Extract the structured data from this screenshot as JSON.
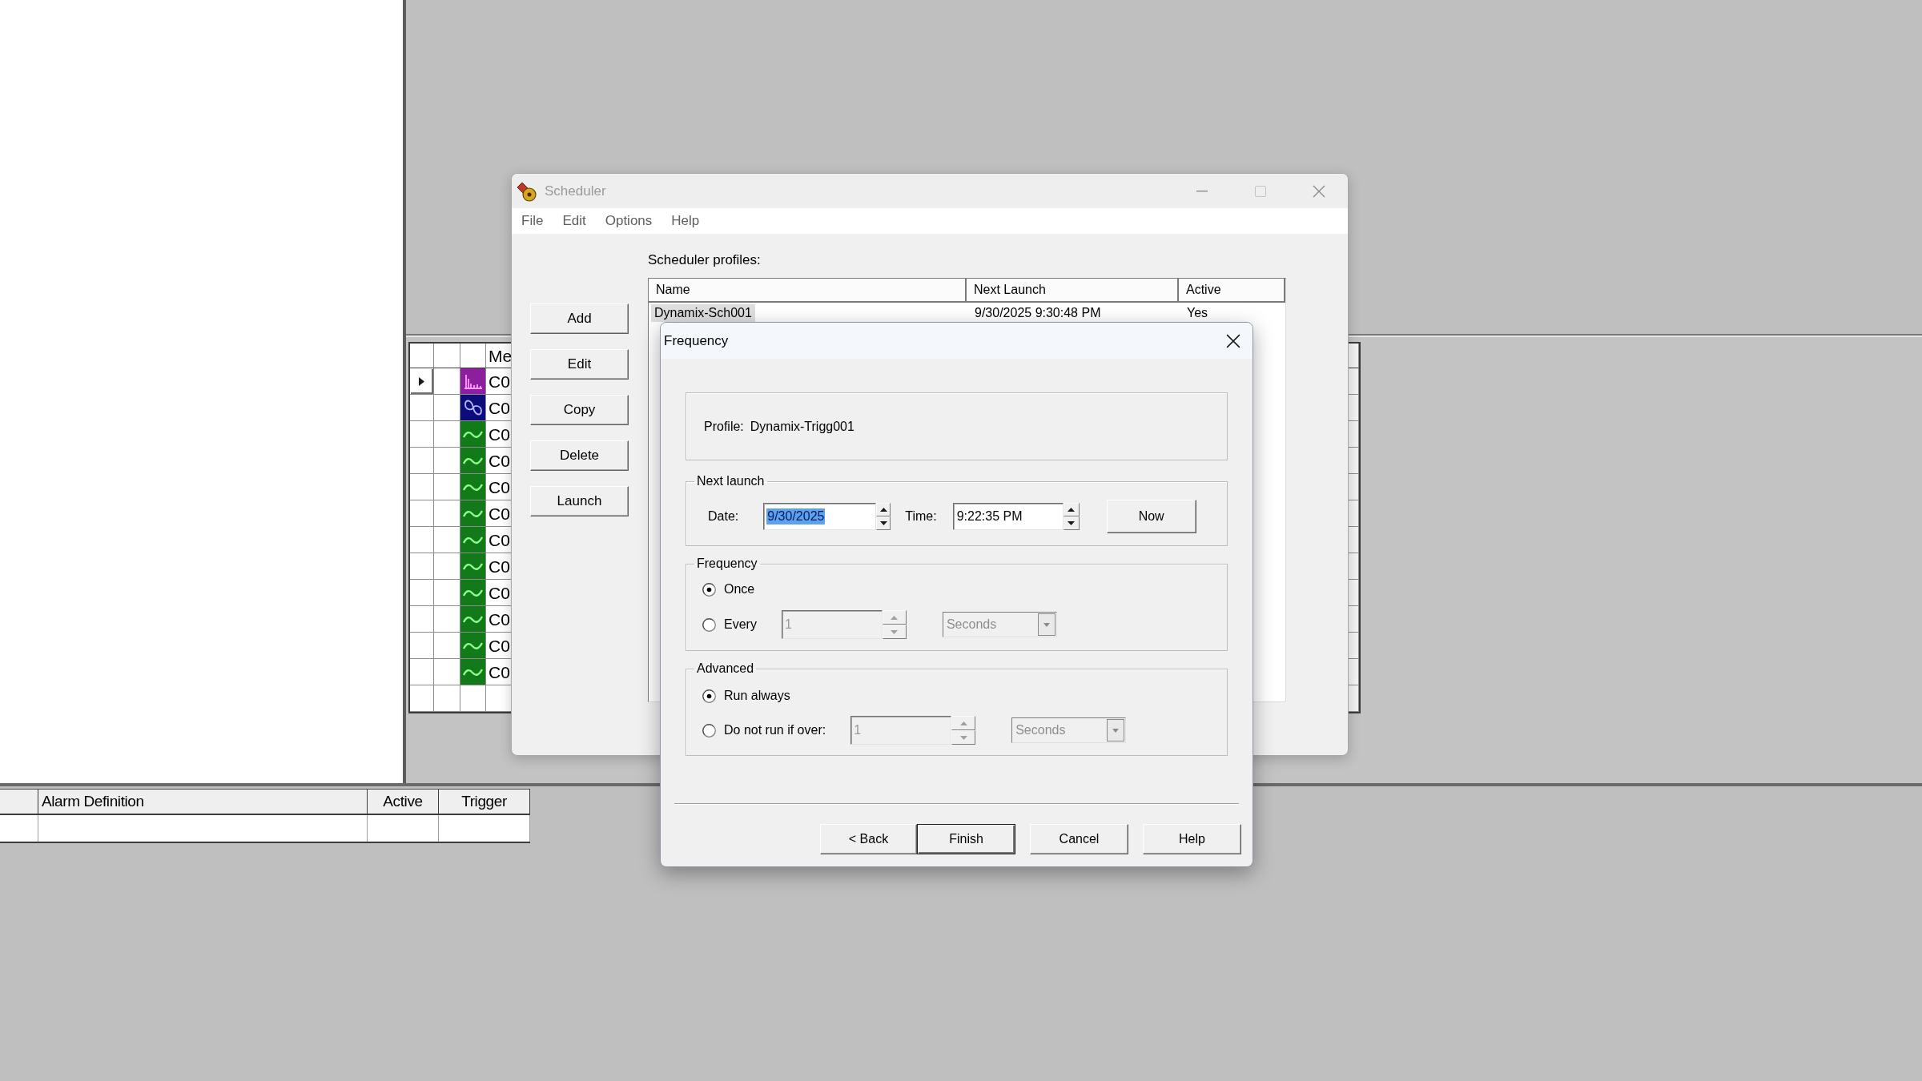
{
  "workspace": {
    "grid": {
      "header": "Me",
      "rows": [
        {
          "selected": true,
          "kind": "spectrum",
          "color": "#8b1f9e",
          "cell": "C0"
        },
        {
          "selected": false,
          "kind": "orbit",
          "color": "#0c0c7a",
          "cell": "C0"
        },
        {
          "selected": false,
          "kind": "wave",
          "color": "#137a19",
          "cell": "C0"
        },
        {
          "selected": false,
          "kind": "wave",
          "color": "#137a19",
          "cell": "C0"
        },
        {
          "selected": false,
          "kind": "wave",
          "color": "#137a19",
          "cell": "C0"
        },
        {
          "selected": false,
          "kind": "wave",
          "color": "#137a19",
          "cell": "C0"
        },
        {
          "selected": false,
          "kind": "wave",
          "color": "#137a19",
          "cell": "C0"
        },
        {
          "selected": false,
          "kind": "wave",
          "color": "#137a19",
          "cell": "C0"
        },
        {
          "selected": false,
          "kind": "wave",
          "color": "#137a19",
          "cell": "C0"
        },
        {
          "selected": false,
          "kind": "wave",
          "color": "#137a19",
          "cell": "C0"
        },
        {
          "selected": false,
          "kind": "wave",
          "color": "#137a19",
          "cell": "C0"
        },
        {
          "selected": false,
          "kind": "wave",
          "color": "#137a19",
          "cell": "C0"
        }
      ]
    },
    "alarm_table": {
      "columns": [
        "Alarm Definition",
        "Active",
        "Trigger"
      ]
    }
  },
  "scheduler": {
    "title": "Scheduler",
    "active": false,
    "menu": [
      "File",
      "Edit",
      "Options",
      "Help"
    ],
    "buttons": [
      "Add",
      "Edit",
      "Copy",
      "Delete",
      "Launch"
    ],
    "profiles_label": "Scheduler profiles:",
    "profiles": {
      "columns": [
        "Name",
        "Next Launch",
        "Active"
      ],
      "rows": [
        {
          "selected": true,
          "cells": [
            "Dynamix-Sch001",
            "9/30/2025 9:30:48 PM",
            "Yes"
          ]
        }
      ]
    }
  },
  "frequency_dialog": {
    "title": "Frequency",
    "active": true,
    "profile": {
      "label": "Profile:",
      "value": "Dynamix-Trigg001"
    },
    "next_launch": {
      "legend": "Next launch",
      "date": {
        "label": "Date:",
        "value": "9/30/2025",
        "highlighted": true
      },
      "time": {
        "label": "Time:",
        "value": "9:22:35 PM",
        "highlighted": false
      },
      "now_button": "Now"
    },
    "frequency": {
      "legend": "Frequency",
      "options": [
        {
          "kind": "plain",
          "label": "Once",
          "selected": true
        },
        {
          "kind": "interval",
          "label": "Every",
          "selected": false,
          "value": "1",
          "unit": "Seconds",
          "disabled": true
        }
      ]
    },
    "advanced": {
      "legend": "Advanced",
      "options": [
        {
          "kind": "plain",
          "label": "Run always",
          "selected": true
        },
        {
          "kind": "interval",
          "label": "Do not run if over:",
          "selected": false,
          "value": "1",
          "unit": "Seconds",
          "disabled": true
        }
      ]
    },
    "wizard_buttons": [
      {
        "label": "< Back",
        "default": false
      },
      {
        "label": "Finish",
        "default": true
      }
    ],
    "buttons": [
      {
        "label": "Cancel",
        "default": false
      },
      {
        "label": "Help",
        "default": false
      }
    ]
  }
}
